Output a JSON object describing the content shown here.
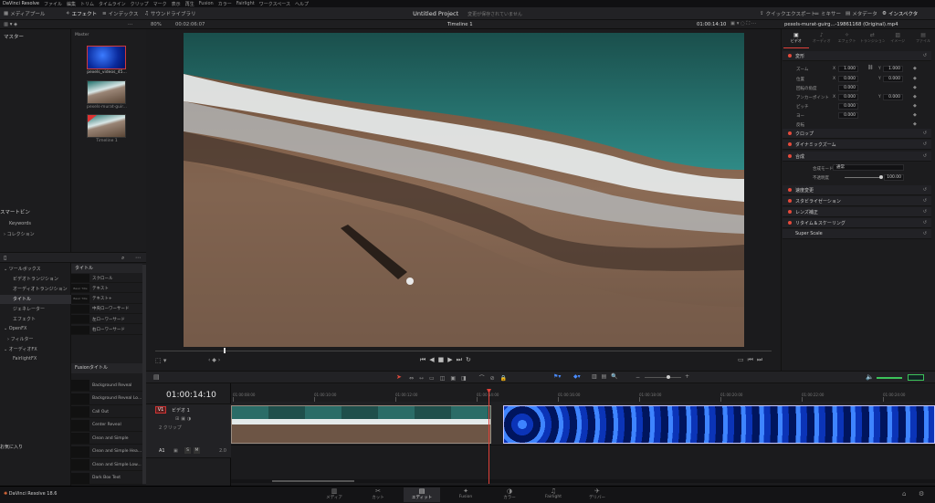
{
  "menubar": {
    "items": [
      "DaVinci Resolve",
      "ファイル",
      "編集",
      "トリム",
      "タイムライン",
      "クリップ",
      "マーク",
      "表示",
      "再生",
      "Fusion",
      "カラー",
      "Fairlight",
      "ワークスペース",
      "ヘルプ"
    ]
  },
  "toolbar": {
    "media_pool": "メディアプール",
    "effects": "エフェクト",
    "edit_index": "インデックス",
    "sound_library": "サウンドライブラリ",
    "project_title": "Untitled Project",
    "unsaved": "変更が保存されていません",
    "quick_export": "クイックエクスポート",
    "mixer": "ミキサー",
    "metadata": "メタデータ",
    "inspector": "インスペクタ"
  },
  "viewer": {
    "zoom": "80%",
    "duration": "00:02:06:07",
    "timeline_name": "Timeline 1",
    "timecode": "01:00:14:10",
    "clip_name": "pexels-murat-guirg...-19861168 (Original).mp4"
  },
  "media_pool": {
    "master_label": "マスター",
    "master_bin": "Master",
    "clips": [
      {
        "label": "pexels_videos_45..."
      },
      {
        "label": "pexels-murat-guir..."
      },
      {
        "label": "Timeline 1"
      }
    ],
    "smart_bin": "スマートビン",
    "smart_items": [
      "Keywords",
      "コレクション"
    ]
  },
  "effects": {
    "tree": [
      "ツールボックス",
      "ビデオトランジション",
      "オーディオトランジション",
      "タイトル",
      "ジェネレーター",
      "エフェクト",
      "OpenFX",
      "フィルター",
      "オーディオFX",
      "FairlightFX"
    ],
    "favorites": "お気に入り",
    "titles_header": "タイトル",
    "titles": [
      {
        "thumb": "",
        "label": "スクロール"
      },
      {
        "thumb": "Basic Title",
        "label": "テキスト"
      },
      {
        "thumb": "Basic Title",
        "label": "テキスト+"
      },
      {
        "thumb": "",
        "label": "中央ローワーサード"
      },
      {
        "thumb": "",
        "label": "左ローワーサード"
      },
      {
        "thumb": "",
        "label": "右ローワーサード"
      }
    ],
    "fusion_header": "Fusionタイトル",
    "fusion_titles": [
      "Background Reveal",
      "Background Reveal Lo...",
      "Call Out",
      "Center Reveal",
      "Clean and Simple",
      "Clean and Simple Hea...",
      "Clean and Simple Low...",
      "Dark Box Text"
    ]
  },
  "inspector": {
    "tabs": [
      "ビデオ",
      "オーディオ",
      "エフェクト",
      "トランジション",
      "イメージ",
      "ファイル"
    ],
    "sections": [
      "変形",
      "クロップ",
      "ダイナミックズーム",
      "合成",
      "速度変更",
      "スタビライゼーション",
      "レンズ補正",
      "リタイム＆スケーリング",
      "Super Scale"
    ],
    "props": {
      "zoom": "ズーム",
      "position": "位置",
      "rotation": "回転の角度",
      "anchor": "アンカーポイント",
      "pitch": "ピッチ",
      "yaw": "ヨー",
      "flip": "反転",
      "zoom_x": "1.000",
      "zoom_y": "1.000",
      "pos_x": "0.000",
      "pos_y": "0.000",
      "rot": "0.000",
      "anchor_x": "0.000",
      "anchor_y": "0.000",
      "pitch_v": "0.000",
      "yaw_v": "0.000",
      "blend_mode_label": "合成モード",
      "blend_mode": "通常",
      "opacity_label": "不透明度",
      "opacity": "100.00",
      "x_label": "X",
      "y_label": "Y"
    }
  },
  "timeline": {
    "timecode": "01:00:14:10",
    "ruler": [
      "01:00:08:00",
      "01:00:10:00",
      "01:00:12:00",
      "01:00:14:00",
      "01:00:16:00",
      "01:00:18:00",
      "01:00:20:00",
      "01:00:22:00",
      "01:00:24:00"
    ],
    "v1": "V1",
    "v1_name": "ビデオ 1",
    "v1_clips": "2 クリップ",
    "a1": "A1",
    "a1_level": "2.0",
    "s_label": "S",
    "m_label": "M"
  },
  "app": {
    "brand": "DaVinci Resolve 18.6"
  },
  "bottom_nav": [
    "メディア",
    "カット",
    "エディット",
    "Fusion",
    "カラー",
    "Fairlight",
    "デリバー"
  ]
}
